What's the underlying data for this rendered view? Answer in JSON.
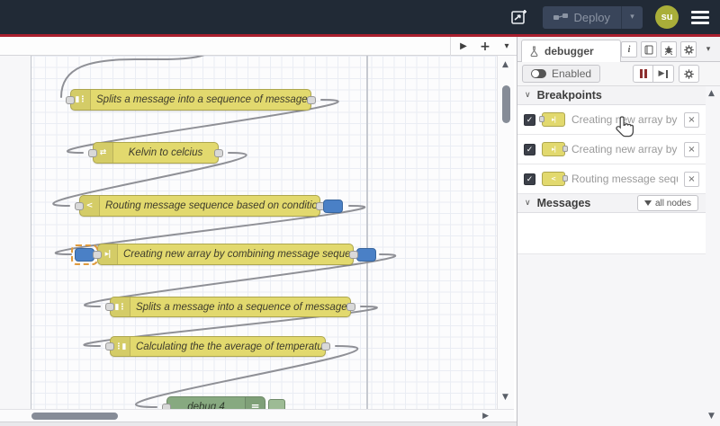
{
  "colors": {
    "node_yellow": "#e2d96e",
    "node_green": "#87a980",
    "breakpoint_blue": "#4a80c6",
    "accent_red": "#aa1f2e"
  },
  "header": {
    "deploy_label": "Deploy",
    "avatar_text": "su"
  },
  "canvas": {
    "nodes": [
      {
        "label": "Splits a message into a sequence of messages.",
        "icon": "▮⋮"
      },
      {
        "label": "Kelvin to celcius",
        "icon": "⇄"
      },
      {
        "label": "Routing message sequence based on condition",
        "icon": "<"
      },
      {
        "label": "Creating new array by combining message sequence",
        "icon": "▸|"
      },
      {
        "label": "Splits a message into a sequence of messages.",
        "icon": "▮⋮"
      },
      {
        "label": "Calculating the the average of temperature",
        "icon": "⋮▮"
      },
      {
        "label": "debug 4",
        "icon": "≡"
      }
    ]
  },
  "sidebar": {
    "tab_label": "debugger",
    "toolbar": {
      "enabled_label": "Enabled"
    },
    "breakpoints": {
      "title": "Breakpoints",
      "items": [
        {
          "label": "Creating new array by combini",
          "glyph": "▸|"
        },
        {
          "label": "Creating new array by combini",
          "glyph": "▸|"
        },
        {
          "label": "Routing message sequence ba",
          "glyph": "<"
        }
      ]
    },
    "messages": {
      "title": "Messages",
      "filter_label": "all nodes"
    }
  },
  "glyphs": {
    "chevron_down": "∨",
    "caret_down": "▾",
    "triangle_up": "▲",
    "triangle_down": "▼",
    "triangle_right": "▶",
    "plus": "+",
    "close": "×",
    "check": "✓",
    "info": "i"
  }
}
